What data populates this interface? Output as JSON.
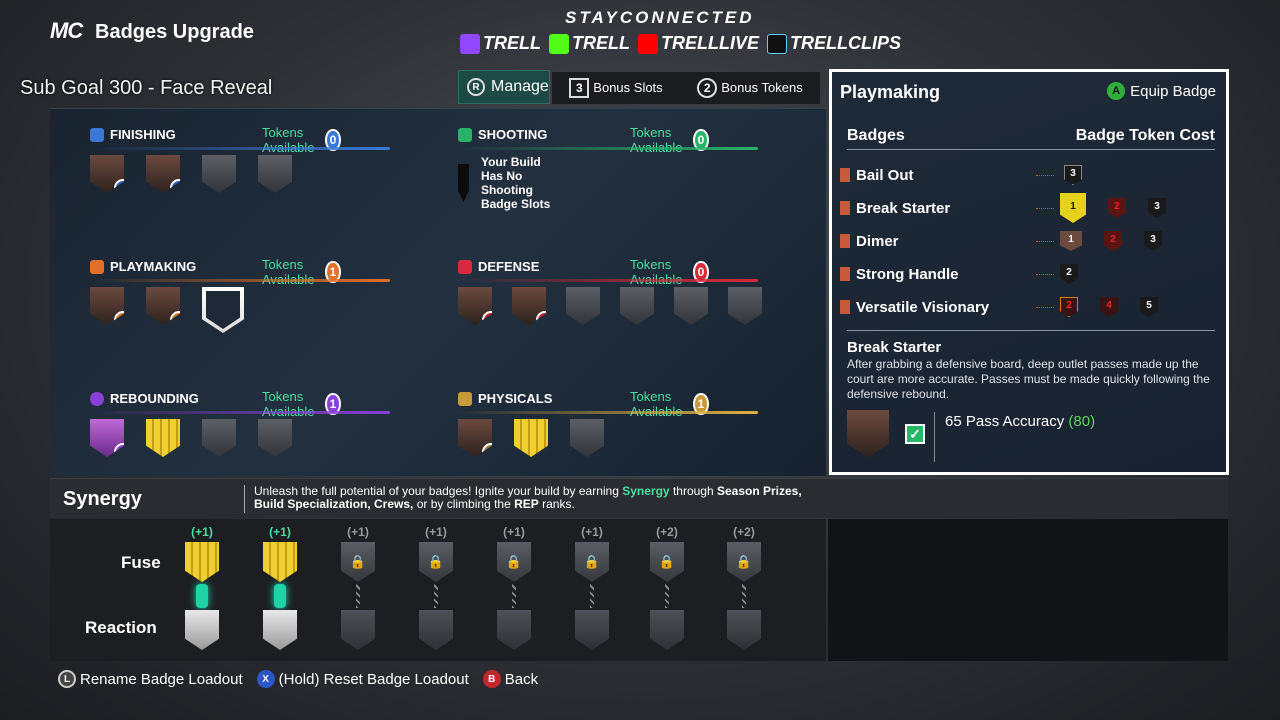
{
  "header": {
    "logo": "MC",
    "title": "Badges Upgrade",
    "stay": "STAYCONNECTED",
    "socials": [
      {
        "name": "TRELL",
        "icon": "twitch-icon",
        "color": "#9146ff"
      },
      {
        "name": "TRELL",
        "icon": "kick-icon",
        "color": "#53fc18"
      },
      {
        "name": "TRELLLIVE",
        "icon": "youtube-icon",
        "color": "#ff0000"
      },
      {
        "name": "TRELLCLIPS",
        "icon": "tiktok-icon",
        "color": "#111111"
      }
    ]
  },
  "overlay": {
    "subgoal": "Sub Goal 300 - Face Reveal"
  },
  "topbar": {
    "manage_btn": "R",
    "manage_label": "Manage",
    "bonus_slots_num": "3",
    "bonus_slots_label": "Bonus Slots",
    "bonus_tokens_num": "2",
    "bonus_tokens_label": "Bonus Tokens"
  },
  "tokens_label": "Tokens Available",
  "categories": {
    "finishing": {
      "name": "FINISHING",
      "tokens": "0",
      "color": "#3a78d8",
      "badges": [
        "2",
        "1"
      ]
    },
    "shooting": {
      "name": "SHOOTING",
      "tokens": "0",
      "color": "#29b36a",
      "message": "Your Build Has No Shooting Badge Slots"
    },
    "playmaking": {
      "name": "PLAYMAKING",
      "tokens": "1",
      "color": "#e0702a",
      "badges": [
        "1",
        "1"
      ]
    },
    "defense": {
      "name": "DEFENSE",
      "tokens": "0",
      "color": "#d82a3a",
      "badges": [
        "3",
        "1"
      ]
    },
    "rebounding": {
      "name": "REBOUNDING",
      "tokens": "1",
      "color": "#8a3fd8",
      "badges": [
        "5"
      ]
    },
    "physicals": {
      "name": "PHYSICALS",
      "tokens": "1",
      "color": "#c89a3a",
      "badges": [
        "2"
      ]
    }
  },
  "panel": {
    "title": "Playmaking",
    "equip_btn": "A",
    "equip_label": "Equip Badge",
    "col_badges": "Badges",
    "col_cost": "Badge Token Cost",
    "badges": [
      {
        "name": "Bail Out",
        "costs": [
          "3"
        ]
      },
      {
        "name": "Break Starter",
        "costs": [
          "1",
          "2",
          "3"
        ]
      },
      {
        "name": "Dimer",
        "costs": [
          "1",
          "2",
          "3"
        ]
      },
      {
        "name": "Strong Handle",
        "costs": [
          "2"
        ]
      },
      {
        "name": "Versatile Visionary",
        "costs": [
          "2",
          "4",
          "5"
        ]
      }
    ],
    "detail": {
      "name": "Break Starter",
      "desc": "After grabbing a defensive board, deep outlet passes made up the court are more accurate. Passes must be made quickly following the defensive rebound.",
      "stat": "65 Pass Accuracy",
      "stat_req": "(80)",
      "check": "✓"
    }
  },
  "synergy": {
    "title": "Synergy",
    "text_pre": "Unleash the full potential of your badges! Ignite your build by earning ",
    "text_syn": "Synergy",
    "text_mid": " through ",
    "text_season": "Season Prizes, Build Specialization, Crews,",
    "text_or": " or by climbing the ",
    "text_rep": "REP",
    "text_end": " ranks.",
    "fuse_label": "Fuse",
    "reaction_label": "Reaction",
    "plus": [
      "(+1)",
      "(+1)",
      "(+1)",
      "(+1)",
      "(+1)",
      "(+1)",
      "(+2)",
      "(+2)"
    ]
  },
  "footer": [
    {
      "btn": "L",
      "label": "Rename Badge Loadout",
      "color": "#444"
    },
    {
      "btn": "X",
      "label": "(Hold) Reset Badge Loadout",
      "color": "#2a56c6"
    },
    {
      "btn": "B",
      "label": "Back",
      "color": "#c0282d"
    }
  ]
}
